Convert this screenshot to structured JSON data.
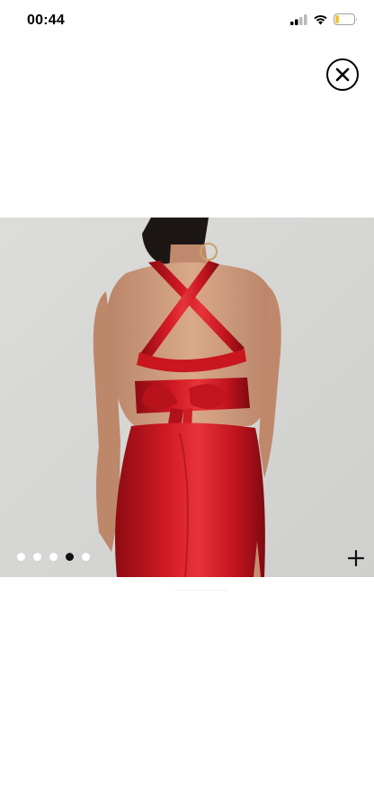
{
  "status_bar": {
    "time": "00:44",
    "icons": [
      "signal-icon",
      "wifi-icon",
      "battery-icon"
    ],
    "battery_level": 0.2,
    "battery_color": "#f4c430"
  },
  "viewer": {
    "close_icon": "close-icon",
    "zoom_icon": "plus-icon",
    "image_description_color": "#c8141c",
    "pagination": {
      "total": 5,
      "active_index": 3
    }
  }
}
